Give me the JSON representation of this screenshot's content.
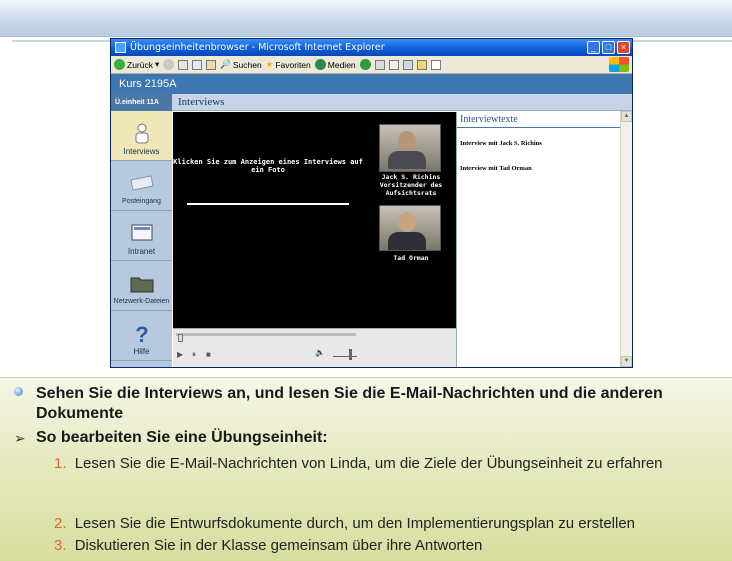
{
  "window": {
    "title": "Übungseinheitenbrowser - Microsoft Internet Explorer",
    "buttons": [
      "_",
      "□",
      "×"
    ]
  },
  "toolbar": {
    "back": "Zurück",
    "search": "Suchen",
    "favorites": "Favoriten",
    "media": "Medien"
  },
  "app": {
    "course": "Kurs 2195A",
    "unit": "Ü.einheit 11A",
    "section_title": "Interviews",
    "nav": [
      {
        "label": "Interviews",
        "icon": "person-icon",
        "active": true
      },
      {
        "label": "Posteingang",
        "icon": "envelope-icon",
        "active": false
      },
      {
        "label": "Intranet",
        "icon": "intranet-icon",
        "active": false
      },
      {
        "label": "Netzwerk-Dateien",
        "icon": "folder-icon",
        "active": false
      },
      {
        "label": "Hilfe",
        "icon": "question-icon",
        "active": false
      }
    ],
    "video_message": "Klicken Sie zum Anzeigen eines Interviews auf ein Foto",
    "person1_caption": "Jack S. Richins Vorsitzender des Aufsichtsrats",
    "person2_caption": "Tad Orman",
    "texts_header": "Interviewtexte",
    "texts": [
      "Interview mit Jack S. Richins",
      "Interview mit Tad Orman"
    ]
  },
  "slide": {
    "bullet1": "Sehen Sie die Interviews an, und lesen Sie die E-Mail-Nachrichten und die anderen Dokumente",
    "bullet2": "So bearbeiten Sie eine Übungseinheit:",
    "steps": [
      {
        "num": "1.",
        "text": "Lesen Sie die E-Mail-Nachrichten von Linda, um die Ziele der Übungseinheit zu erfahren"
      },
      {
        "num": "2.",
        "text": "Lesen Sie die Entwurfsdokumente durch, um den Implementierungsplan zu erstellen"
      },
      {
        "num": "3.",
        "text": "Diskutieren Sie in der Klasse gemeinsam über ihre Antworten"
      }
    ]
  }
}
